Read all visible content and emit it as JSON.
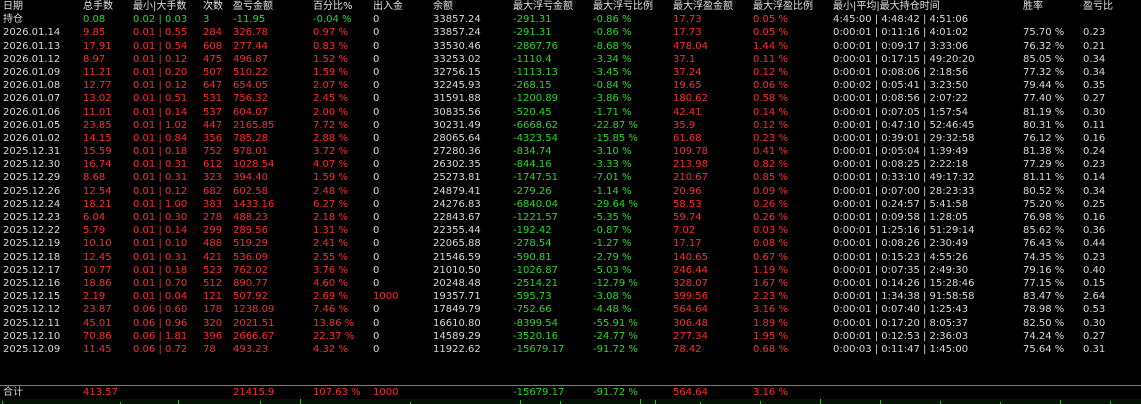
{
  "headers": [
    "日期",
    "总手数",
    "最小|大手数",
    "次数",
    "盈亏金额",
    "百分比%",
    "出入金",
    "余额",
    "最大浮亏金额",
    "最大浮亏比例",
    "最大浮盈金额",
    "最大浮盈比例",
    "最小|平均|最大持仓时间",
    "胜率",
    "盈亏比"
  ],
  "colors": {
    "profit": "#ff2a2a",
    "loss": "#25d925",
    "neutral": "#d8d8d8",
    "background": "#000000"
  },
  "position_row": {
    "label": "持仓",
    "cells": [
      "0.08",
      "0.02 | 0.03",
      "3",
      "-11.95",
      "-0.04 %",
      "0",
      "33857.24",
      "-291.31",
      "-0.86 %",
      "17.73",
      "0.05 %",
      "4:45:00 | 4:48:42 | 4:51:06",
      "",
      ""
    ],
    "colors": [
      "green",
      "green",
      "green",
      "green",
      "green",
      "white",
      "white",
      "green",
      "green",
      "red",
      "red",
      "white",
      "white",
      "white"
    ]
  },
  "rows": [
    {
      "date": "2026.01.14",
      "total_lots": "9.85",
      "min_max_lots": "0.01 | 0.55",
      "count": "284",
      "pnl": "326.78",
      "pct": "0.97 %",
      "deposit": "0",
      "balance": "33857.24",
      "max_float_loss": "-291.31",
      "max_float_loss_pct": "-0.86 %",
      "max_float_profit": "17.73",
      "max_float_profit_pct": "0.05 %",
      "hold_time": "0:00:01 | 0:11:16 | 4:01:02",
      "win_rate": "75.70 %",
      "pl_ratio": "0.23"
    },
    {
      "date": "2026.01.13",
      "total_lots": "17.91",
      "min_max_lots": "0.01 | 0.54",
      "count": "608",
      "pnl": "277.44",
      "pct": "0.83 %",
      "deposit": "0",
      "balance": "33530.46",
      "max_float_loss": "-2867.76",
      "max_float_loss_pct": "-8.68 %",
      "max_float_profit": "478.04",
      "max_float_profit_pct": "1.44 %",
      "hold_time": "0:00:01 | 0:09:17 | 3:33:06",
      "win_rate": "76.32 %",
      "pl_ratio": "0.21"
    },
    {
      "date": "2026.01.12",
      "total_lots": "8.97",
      "min_max_lots": "0.01 | 0.12",
      "count": "475",
      "pnl": "496.87",
      "pct": "1.52 %",
      "deposit": "0",
      "balance": "33253.02",
      "max_float_loss": "-1110.4",
      "max_float_loss_pct": "-3.34 %",
      "max_float_profit": "37.1",
      "max_float_profit_pct": "0.11 %",
      "hold_time": "0:00:01 | 0:17:15 | 49:20:20",
      "win_rate": "85.05 %",
      "pl_ratio": "0.34"
    },
    {
      "date": "2026.01.09",
      "total_lots": "11.21",
      "min_max_lots": "0.01 | 0.20",
      "count": "507",
      "pnl": "510.22",
      "pct": "1.59 %",
      "deposit": "0",
      "balance": "32756.15",
      "max_float_loss": "-1113.13",
      "max_float_loss_pct": "-3.45 %",
      "max_float_profit": "37.24",
      "max_float_profit_pct": "0.12 %",
      "hold_time": "0:00:01 | 0:08:06 | 2:18:56",
      "win_rate": "77.32 %",
      "pl_ratio": "0.34"
    },
    {
      "date": "2026.01.08",
      "total_lots": "12.77",
      "min_max_lots": "0.01 | 0.12",
      "count": "647",
      "pnl": "654.05",
      "pct": "2.07 %",
      "deposit": "0",
      "balance": "32245.93",
      "max_float_loss": "-268.15",
      "max_float_loss_pct": "-0.84 %",
      "max_float_profit": "19.65",
      "max_float_profit_pct": "0.06 %",
      "hold_time": "0:00:02 | 0:05:41 | 3:23:50",
      "win_rate": "79.44 %",
      "pl_ratio": "0.35"
    },
    {
      "date": "2026.01.07",
      "total_lots": "13.02",
      "min_max_lots": "0.01 | 0.51",
      "count": "531",
      "pnl": "756.32",
      "pct": "2.45 %",
      "deposit": "0",
      "balance": "31591.88",
      "max_float_loss": "-1200.89",
      "max_float_loss_pct": "-3.86 %",
      "max_float_profit": "180.62",
      "max_float_profit_pct": "0.58 %",
      "hold_time": "0:00:01 | 0:08:56 | 2:07:22",
      "win_rate": "77.40 %",
      "pl_ratio": "0.27"
    },
    {
      "date": "2026.01.06",
      "total_lots": "11.01",
      "min_max_lots": "0.01 | 0.14",
      "count": "537",
      "pnl": "604.07",
      "pct": "2.00 %",
      "deposit": "0",
      "balance": "30835.56",
      "max_float_loss": "-520.45",
      "max_float_loss_pct": "-1.71 %",
      "max_float_profit": "42.41",
      "max_float_profit_pct": "0.14 %",
      "hold_time": "0:00:01 | 0:07:05 | 1:57:54",
      "win_rate": "81.19 %",
      "pl_ratio": "0.30"
    },
    {
      "date": "2026.01.05",
      "total_lots": "23.85",
      "min_max_lots": "0.01 | 1.02",
      "count": "447",
      "pnl": "2165.85",
      "pct": "7.72 %",
      "deposit": "0",
      "balance": "30231.49",
      "max_float_loss": "-6668.62",
      "max_float_loss_pct": "-22.87 %",
      "max_float_profit": "35.9",
      "max_float_profit_pct": "0.12 %",
      "hold_time": "0:00:01 | 0:47:10 | 52:46:45",
      "win_rate": "80.31 %",
      "pl_ratio": "0.11"
    },
    {
      "date": "2026.01.02",
      "total_lots": "14.15",
      "min_max_lots": "0.01 | 0.84",
      "count": "356",
      "pnl": "785.28",
      "pct": "2.88 %",
      "deposit": "0",
      "balance": "28065.64",
      "max_float_loss": "-4323.54",
      "max_float_loss_pct": "-15.85 %",
      "max_float_profit": "61.68",
      "max_float_profit_pct": "0.23 %",
      "hold_time": "0:00:01 | 0:39:01 | 29:32:58",
      "win_rate": "76.12 %",
      "pl_ratio": "0.16"
    },
    {
      "date": "2025.12.31",
      "total_lots": "15.59",
      "min_max_lots": "0.01 | 0.18",
      "count": "752",
      "pnl": "978.01",
      "pct": "3.72 %",
      "deposit": "0",
      "balance": "27280.36",
      "max_float_loss": "-834.74",
      "max_float_loss_pct": "-3.10 %",
      "max_float_profit": "109.78",
      "max_float_profit_pct": "0.41 %",
      "hold_time": "0:00:01 | 0:05:04 | 1:39:49",
      "win_rate": "81.38 %",
      "pl_ratio": "0.24"
    },
    {
      "date": "2025.12.30",
      "total_lots": "16.74",
      "min_max_lots": "0.01 | 0.31",
      "count": "612",
      "pnl": "1028.54",
      "pct": "4.07 %",
      "deposit": "0",
      "balance": "26302.35",
      "max_float_loss": "-844.16",
      "max_float_loss_pct": "-3.33 %",
      "max_float_profit": "213.98",
      "max_float_profit_pct": "0.82 %",
      "hold_time": "0:00:01 | 0:08:25 | 2:22:18",
      "win_rate": "77.29 %",
      "pl_ratio": "0.23"
    },
    {
      "date": "2025.12.29",
      "total_lots": "8.68",
      "min_max_lots": "0.01 | 0.31",
      "count": "323",
      "pnl": "394.40",
      "pct": "1.59 %",
      "deposit": "0",
      "balance": "25273.81",
      "max_float_loss": "-1747.51",
      "max_float_loss_pct": "-7.01 %",
      "max_float_profit": "210.67",
      "max_float_profit_pct": "0.85 %",
      "hold_time": "0:00:01 | 0:33:10 | 49:17:32",
      "win_rate": "81.11 %",
      "pl_ratio": "0.14"
    },
    {
      "date": "2025.12.26",
      "total_lots": "12.54",
      "min_max_lots": "0.01 | 0.12",
      "count": "682",
      "pnl": "602.58",
      "pct": "2.48 %",
      "deposit": "0",
      "balance": "24879.41",
      "max_float_loss": "-279.26",
      "max_float_loss_pct": "-1.14 %",
      "max_float_profit": "20.96",
      "max_float_profit_pct": "0.09 %",
      "hold_time": "0:00:01 | 0:07:00 | 28:23:33",
      "win_rate": "80.52 %",
      "pl_ratio": "0.34"
    },
    {
      "date": "2025.12.24",
      "total_lots": "18.21",
      "min_max_lots": "0.01 | 1.00",
      "count": "383",
      "pnl": "1433.16",
      "pct": "6.27 %",
      "deposit": "0",
      "balance": "24276.83",
      "max_float_loss": "-6840.04",
      "max_float_loss_pct": "-29.64 %",
      "max_float_profit": "58.53",
      "max_float_profit_pct": "0.26 %",
      "hold_time": "0:00:01 | 0:24:57 | 5:41:58",
      "win_rate": "75.20 %",
      "pl_ratio": "0.25"
    },
    {
      "date": "2025.12.23",
      "total_lots": "6.04",
      "min_max_lots": "0.01 | 0.30",
      "count": "278",
      "pnl": "488.23",
      "pct": "2.18 %",
      "deposit": "0",
      "balance": "22843.67",
      "max_float_loss": "-1221.57",
      "max_float_loss_pct": "-5.35 %",
      "max_float_profit": "59.74",
      "max_float_profit_pct": "0.26 %",
      "hold_time": "0:00:01 | 0:09:58 | 1:28:05",
      "win_rate": "76.98 %",
      "pl_ratio": "0.16"
    },
    {
      "date": "2025.12.22",
      "total_lots": "5.79",
      "min_max_lots": "0.01 | 0.14",
      "count": "299",
      "pnl": "289.56",
      "pct": "1.31 %",
      "deposit": "0",
      "balance": "22355.44",
      "max_float_loss": "-192.42",
      "max_float_loss_pct": "-0.87 %",
      "max_float_profit": "7.02",
      "max_float_profit_pct": "0.03 %",
      "hold_time": "0:00:01 | 1:25:16 | 51:29:14",
      "win_rate": "85.62 %",
      "pl_ratio": "0.36"
    },
    {
      "date": "2025.12.19",
      "total_lots": "10.10",
      "min_max_lots": "0.01 | 0.10",
      "count": "488",
      "pnl": "519.29",
      "pct": "2.41 %",
      "deposit": "0",
      "balance": "22065.88",
      "max_float_loss": "-278.54",
      "max_float_loss_pct": "-1.27 %",
      "max_float_profit": "17.17",
      "max_float_profit_pct": "0.08 %",
      "hold_time": "0:00:01 | 0:08:26 | 2:30:49",
      "win_rate": "76.43 %",
      "pl_ratio": "0.44"
    },
    {
      "date": "2025.12.18",
      "total_lots": "12.45",
      "min_max_lots": "0.01 | 0.31",
      "count": "421",
      "pnl": "536.09",
      "pct": "2.55 %",
      "deposit": "0",
      "balance": "21546.59",
      "max_float_loss": "-590.81",
      "max_float_loss_pct": "-2.79 %",
      "max_float_profit": "140.65",
      "max_float_profit_pct": "0.67 %",
      "hold_time": "0:00:01 | 0:15:23 | 4:55:26",
      "win_rate": "74.35 %",
      "pl_ratio": "0.23"
    },
    {
      "date": "2025.12.17",
      "total_lots": "10.77",
      "min_max_lots": "0.01 | 0.18",
      "count": "523",
      "pnl": "762.02",
      "pct": "3.76 %",
      "deposit": "0",
      "balance": "21010.50",
      "max_float_loss": "-1026.87",
      "max_float_loss_pct": "-5.03 %",
      "max_float_profit": "246.44",
      "max_float_profit_pct": "1.19 %",
      "hold_time": "0:00:01 | 0:07:35 | 2:49:30",
      "win_rate": "79.16 %",
      "pl_ratio": "0.40"
    },
    {
      "date": "2025.12.16",
      "total_lots": "18.86",
      "min_max_lots": "0.01 | 0.70",
      "count": "512",
      "pnl": "890.77",
      "pct": "4.60 %",
      "deposit": "0",
      "balance": "20248.48",
      "max_float_loss": "-2514.21",
      "max_float_loss_pct": "-12.79 %",
      "max_float_profit": "328.07",
      "max_float_profit_pct": "1.67 %",
      "hold_time": "0:00:01 | 0:14:26 | 15:28:46",
      "win_rate": "77.15 %",
      "pl_ratio": "0.15"
    },
    {
      "date": "2025.12.15",
      "total_lots": "2.19",
      "min_max_lots": "0.01 | 0.04",
      "count": "121",
      "pnl": "507.92",
      "pct": "2.69 %",
      "deposit": "1000",
      "balance": "19357.71",
      "max_float_loss": "-595.73",
      "max_float_loss_pct": "-3.08 %",
      "max_float_profit": "399.56",
      "max_float_profit_pct": "2.23 %",
      "hold_time": "0:00:01 | 1:34:38 | 91:58:58",
      "win_rate": "83.47 %",
      "pl_ratio": "2.64"
    },
    {
      "date": "2025.12.12",
      "total_lots": "23.87",
      "min_max_lots": "0.06 | 0.60",
      "count": "178",
      "pnl": "1238.09",
      "pct": "7.46 %",
      "deposit": "0",
      "balance": "17849.79",
      "max_float_loss": "-752.66",
      "max_float_loss_pct": "-4.48 %",
      "max_float_profit": "564.64",
      "max_float_profit_pct": "3.16 %",
      "hold_time": "0:00:01 | 0:07:40 | 1:25:43",
      "win_rate": "78.98 %",
      "pl_ratio": "0.53"
    },
    {
      "date": "2025.12.11",
      "total_lots": "45.01",
      "min_max_lots": "0.06 | 0.96",
      "count": "320",
      "pnl": "2021.51",
      "pct": "13.86 %",
      "deposit": "0",
      "balance": "16610.80",
      "max_float_loss": "-8399.54",
      "max_float_loss_pct": "-55.91 %",
      "max_float_profit": "306.48",
      "max_float_profit_pct": "1.89 %",
      "hold_time": "0:00:01 | 0:17:20 | 8:05:37",
      "win_rate": "82.50 %",
      "pl_ratio": "0.30"
    },
    {
      "date": "2025.12.10",
      "total_lots": "70.86",
      "min_max_lots": "0.06 | 1.81",
      "count": "396",
      "pnl": "2666.67",
      "pct": "22.37 %",
      "deposit": "0",
      "balance": "14589.29",
      "max_float_loss": "-3520.16",
      "max_float_loss_pct": "-24.77 %",
      "max_float_profit": "277.34",
      "max_float_profit_pct": "1.95 %",
      "hold_time": "0:00:01 | 0:12:53 | 2:36:03",
      "win_rate": "74.24 %",
      "pl_ratio": "0.27"
    },
    {
      "date": "2025.12.09",
      "total_lots": "11.45",
      "min_max_lots": "0.06 | 0.72",
      "count": "78",
      "pnl": "493.23",
      "pct": "4.32 %",
      "deposit": "0",
      "balance": "11922.62",
      "max_float_loss": "-15679.17",
      "max_float_loss_pct": "-91.72 %",
      "max_float_profit": "78.42",
      "max_float_profit_pct": "0.68 %",
      "hold_time": "0:00:03 | 0:11:47 | 1:45:00",
      "win_rate": "75.64 %",
      "pl_ratio": "0.31"
    }
  ],
  "total_row": {
    "label": "合计",
    "total_lots": "413.57",
    "pnl": "21415.9",
    "pct": "107.63 %",
    "deposit": "1000",
    "max_float_loss": "-15679.17",
    "max_float_loss_pct": "-91.72 %",
    "max_float_profit": "564.64",
    "max_float_profit_pct": "3.16 %"
  }
}
